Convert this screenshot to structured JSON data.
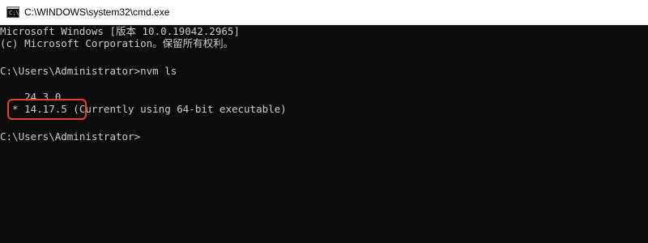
{
  "window": {
    "title": "C:\\WINDOWS\\system32\\cmd.exe",
    "icon": "cmd-icon",
    "icon_text": "C:\\"
  },
  "console": {
    "lines": [
      "Microsoft Windows [版本 10.0.19042.2965]",
      "(c) Microsoft Corporation。保留所有权利。",
      "",
      "C:\\Users\\Administrator>nvm ls",
      "",
      "    24.3.0",
      "  * 14.17.5 (Currently using 64-bit executable)",
      "",
      "C:\\Users\\Administrator>"
    ]
  },
  "annotation": {
    "color": "#e0452a",
    "target": "14.17.5"
  },
  "colors": {
    "console_bg": "#0c0c0c",
    "console_fg": "#cccccc",
    "titlebar_bg": "#ffffff"
  }
}
